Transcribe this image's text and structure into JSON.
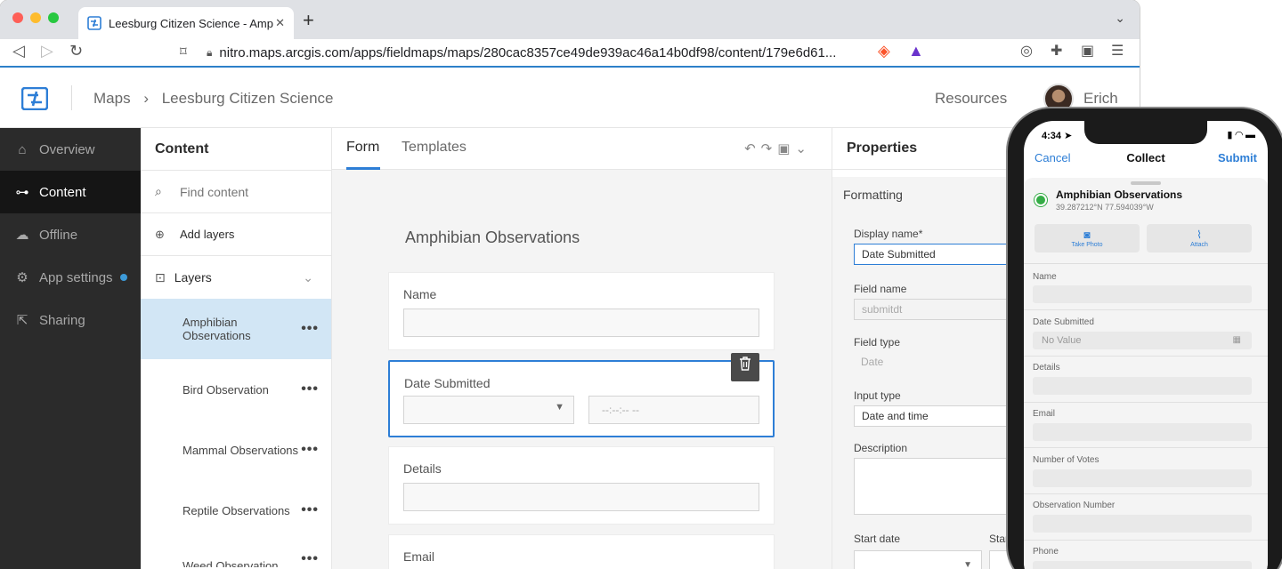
{
  "browser": {
    "tab_title": "Leesburg Citizen Science - Amp",
    "new_tab": "+",
    "url": "nitro.maps.arcgis.com/apps/fieldmaps/maps/280cac8357ce49de939ac46a14b0df98/content/179e6d61..."
  },
  "header": {
    "crumb_maps": "Maps",
    "crumb_sep": "›",
    "crumb_title": "Leesburg Citizen Science",
    "resources": "Resources",
    "user": "Erich"
  },
  "sidebar": {
    "items": [
      {
        "label": "Overview",
        "icon": "home-icon"
      },
      {
        "label": "Content",
        "icon": "layers-icon"
      },
      {
        "label": "Offline",
        "icon": "cloud-icon"
      },
      {
        "label": "App settings",
        "icon": "gear-icon"
      },
      {
        "label": "Sharing",
        "icon": "share-icon"
      }
    ]
  },
  "content": {
    "title": "Content",
    "search_placeholder": "Find content",
    "add_layers": "Add layers",
    "layers_label": "Layers",
    "layers": [
      {
        "line1": "Amphibian",
        "line2": "Observations"
      },
      {
        "line1": "Bird Observation",
        "line2": ""
      },
      {
        "line1": "Mammal Observations",
        "line2": ""
      },
      {
        "line1": "Reptile Observations",
        "line2": ""
      },
      {
        "line1": "Weed Observation",
        "line2": ""
      }
    ],
    "more": "•••"
  },
  "form": {
    "tabs": [
      "Form",
      "Templates"
    ],
    "title": "Amphibian Observations",
    "fields": [
      "Name",
      "Date Submitted",
      "Details",
      "Email"
    ],
    "time_placeholder": "--:--:-- --"
  },
  "properties": {
    "title": "Properties",
    "section": "Formatting",
    "display_name_label": "Display name*",
    "display_name_value": "Date Submitted",
    "field_name_label": "Field name",
    "field_name_value": "submitdt",
    "field_type_label": "Field type",
    "field_type_value": "Date",
    "input_type_label": "Input type",
    "input_type_value": "Date and time",
    "description_label": "Description",
    "start_date_label": "Start date",
    "start_time_label": "Start"
  },
  "phone": {
    "time": "4:34",
    "cancel": "Cancel",
    "collect": "Collect",
    "submit": "Submit",
    "layer_title": "Amphibian Observations",
    "coords": "39.287212°N  77.594039°W",
    "take_photo": "Take Photo",
    "attach": "Attach",
    "no_value": "No Value",
    "fields": [
      "Name",
      "Date Submitted",
      "Details",
      "Email",
      "Number of Votes",
      "Observation Number",
      "Phone"
    ]
  },
  "colors": {
    "accent": "#2d7ed6",
    "sidebar_bg": "#2b2b2b",
    "selected": "#d2e6f5"
  }
}
